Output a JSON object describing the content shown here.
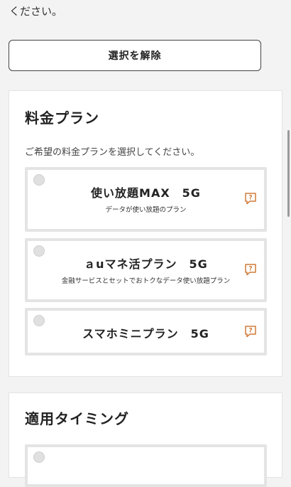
{
  "intro": {
    "text": "ください。"
  },
  "deselect_button": {
    "label": "選択を解除"
  },
  "plan_section": {
    "title": "料金プラン",
    "description": "ご希望の料金プランを選択してください。",
    "options": [
      {
        "name": "使い放題MAX　5G",
        "subtitle": "データが使い放題のプラン",
        "selected": false
      },
      {
        "name": "ａuマネ活プラン　5G",
        "subtitle": "金融サービスとセットでおトクなデータ使い放題プラン",
        "selected": false
      },
      {
        "name": "スマホミニプラン　5G",
        "subtitle": "",
        "selected": false
      }
    ]
  },
  "timing_section": {
    "title": "適用タイミング"
  },
  "colors": {
    "help_icon": "#d27a36",
    "radio_fill": "#e0e0e0",
    "option_border": "#e4e4e4",
    "page_background": "#f3f3f3"
  },
  "icons": {
    "help": "help-icon",
    "radio": "radio-button"
  }
}
